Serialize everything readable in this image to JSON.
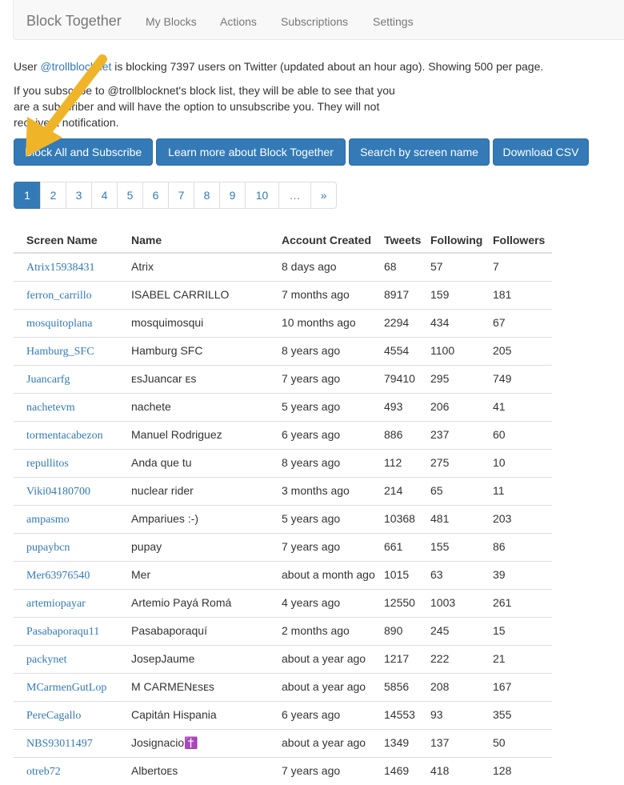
{
  "navbar": {
    "brand": "Block Together",
    "items": [
      "My Blocks",
      "Actions",
      "Subscriptions",
      "Settings"
    ]
  },
  "intro": {
    "prefix": "User ",
    "user_link": "@trollblocknet",
    "suffix": " is blocking 7397 users on Twitter (updated about an hour ago). Showing 500 per page.",
    "subscribe_text": "If you subscribe to @trollblocknet's block list, they will be able to see that you are a subscriber and will have the option to unsubscribe you. They will not receive a notification."
  },
  "buttons": {
    "block_all": "Block All and Subscribe",
    "learn_more": "Learn more about Block Together",
    "search": "Search by screen name",
    "download": "Download CSV"
  },
  "pagination": [
    "1",
    "2",
    "3",
    "4",
    "5",
    "6",
    "7",
    "8",
    "9",
    "10",
    "…",
    "»"
  ],
  "table": {
    "headers": [
      "Screen Name",
      "Name",
      "Account Created",
      "Tweets",
      "Following",
      "Followers"
    ],
    "rows": [
      [
        "Atrix15938431",
        "Atrix",
        "8 days ago",
        "68",
        "57",
        "7"
      ],
      [
        "ferron_carrillo",
        "ISABEL CARRILLO",
        "7 months ago",
        "8917",
        "159",
        "181"
      ],
      [
        "mosquitoplana",
        "mosquimosqui",
        "10 months ago",
        "2294",
        "434",
        "67"
      ],
      [
        "Hamburg_SFC",
        "Hamburg SFC",
        "8 years ago",
        "4554",
        "1100",
        "205"
      ],
      [
        "Juancarfg",
        "ᴇsJuancar ᴇs",
        "7 years ago",
        "79410",
        "295",
        "749"
      ],
      [
        "nachetevm",
        "nachete",
        "5 years ago",
        "493",
        "206",
        "41"
      ],
      [
        "tormentacabezon",
        "Manuel Rodriguez",
        "6 years ago",
        "886",
        "237",
        "60"
      ],
      [
        "repullitos",
        "Anda que tu",
        "8 years ago",
        "112",
        "275",
        "10"
      ],
      [
        "Viki04180700",
        "nuclear rider",
        "3 months ago",
        "214",
        "65",
        "11"
      ],
      [
        "ampasmo",
        "Ampariues :-)",
        "5 years ago",
        "10368",
        "481",
        "203"
      ],
      [
        "pupaybcn",
        "pupay",
        "7 years ago",
        "661",
        "155",
        "86"
      ],
      [
        "Mer63976540",
        "Mer",
        "about a month ago",
        "1015",
        "63",
        "39"
      ],
      [
        "artemiopayar",
        "Artemio Payá Romá",
        "4 years ago",
        "12550",
        "1003",
        "261"
      ],
      [
        "Pasabaporaqu11",
        "Pasabaporaquí",
        "2 months ago",
        "890",
        "245",
        "15"
      ],
      [
        "packynet",
        "JosepJaume",
        "about a year ago",
        "1217",
        "222",
        "21"
      ],
      [
        "MCarmenGutLop",
        "M CARMENᴇsᴇs",
        "about a year ago",
        "5856",
        "208",
        "167"
      ],
      [
        "PereCagallo",
        "Capitán Hispania",
        "6 years ago",
        "14553",
        "93",
        "355"
      ],
      [
        "NBS93011497",
        "Josignacio✝️",
        "about a year ago",
        "1349",
        "137",
        "50"
      ],
      [
        "otreb72",
        "Albertoᴇs",
        "7 years ago",
        "1469",
        "418",
        "128"
      ]
    ]
  },
  "colors": {
    "primary": "#337ab7",
    "arrow": "#f0b429"
  }
}
